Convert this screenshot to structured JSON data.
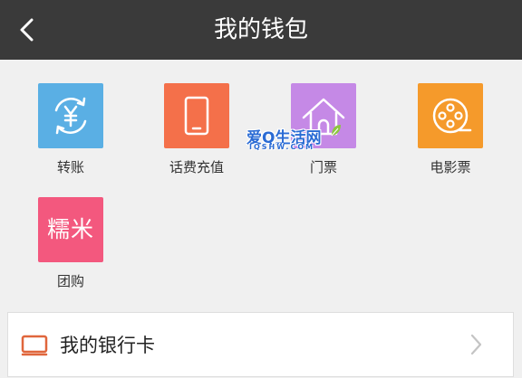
{
  "header": {
    "title": "我的钱包",
    "background": "#3a3a3a"
  },
  "services": [
    {
      "label": "转账",
      "icon": "transfer-yuan-icon",
      "color": "#5aafe4"
    },
    {
      "label": "话费充值",
      "icon": "phone-recharge-icon",
      "color": "#f4704a"
    },
    {
      "label": "门票",
      "icon": "ticket-house-icon",
      "color": "#c589e6"
    },
    {
      "label": "电影票",
      "icon": "film-reel-icon",
      "color": "#f59a2b"
    },
    {
      "label": "团购",
      "icon": "rice-logo-icon",
      "color": "#f3587e",
      "logo_text": "糯米"
    }
  ],
  "watermark": {
    "text": "爱Q生活网",
    "subtext": "IQSHW.COM"
  },
  "bank_card": {
    "label": "我的银行卡",
    "icon": "bank-card-icon",
    "icon_color": "#e0663c"
  }
}
